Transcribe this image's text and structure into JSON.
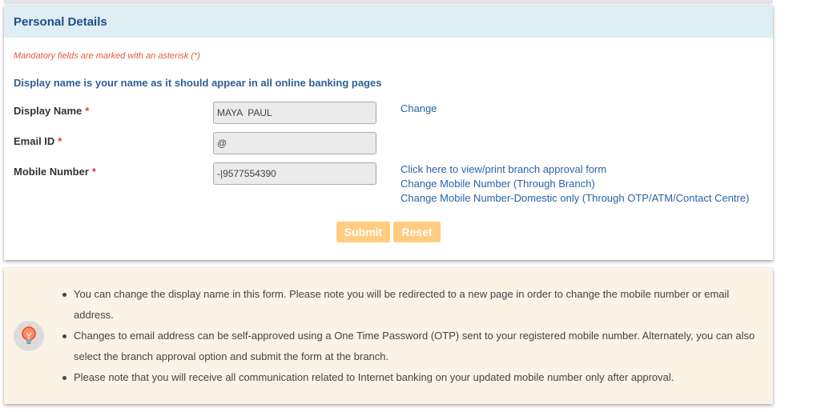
{
  "panel": {
    "title": "Personal Details"
  },
  "form": {
    "mandatory_note": "Mandatory fields are marked with an asterisk (*)",
    "intro": "Display name is your name as it should appear in all online banking pages",
    "required_marker": "*",
    "display_name": {
      "label": "Display Name",
      "value": "MAYA  PAUL"
    },
    "email": {
      "label": "Email ID",
      "value": "@"
    },
    "mobile": {
      "label": "Mobile Number",
      "value": "-|9577554390"
    },
    "change_link": "Change",
    "mobile_links": [
      "Click here to view/print branch approval form",
      "Change Mobile Number (Through Branch)",
      "Change Mobile Number-Domestic only (Through OTP/ATM/Contact Centre)"
    ],
    "submit_label": "Submit",
    "reset_label": "Reset"
  },
  "info": {
    "icon": "lightbulb-icon",
    "items": [
      "You can change the display name in this form. Please note you will be redirected to a new page in order to change the mobile number or email address.",
      "Changes to email address can be self-approved using a One Time Password (OTP) sent to your registered mobile number. Alternately, you can also select the branch approval option and submit the form at the branch.",
      "Please note that you will receive all communication related to Internet banking on your updated mobile number only after approval."
    ]
  },
  "colors": {
    "header_bg": "#dfedf4",
    "title": "#1d4f86",
    "link": "#2b62a8",
    "required": "#e53935",
    "button": "#ffcc80",
    "info_bg": "#fbf3e5"
  }
}
